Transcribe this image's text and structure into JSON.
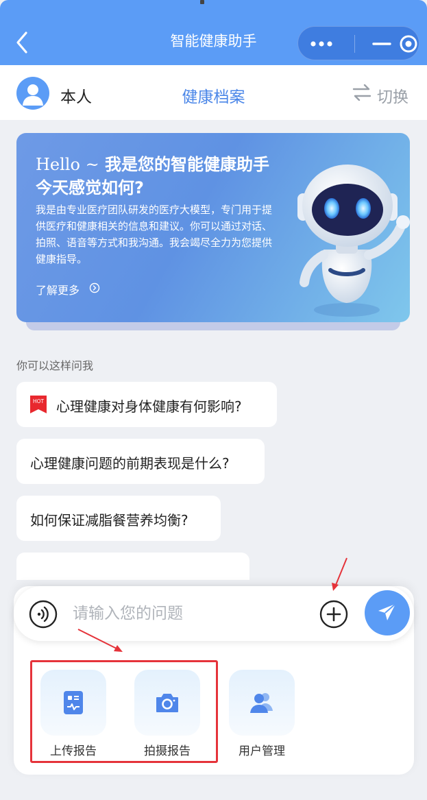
{
  "header": {
    "title": "智能健康助手",
    "back_icon": "chevron-left-icon",
    "capsule_icons": [
      "more-dots-icon",
      "minimize-icon",
      "close-target-icon"
    ]
  },
  "userbar": {
    "user_name": "本人",
    "center_tab": "健康档案",
    "switch_label": "切换",
    "switch_icon": "swap-arrows-icon"
  },
  "banner": {
    "greeting_prefix": "Hello ~",
    "greeting_rest": "我是您的智能健康助手",
    "subtitle": "今天感觉如何?",
    "description": "我是由专业医疗团队研发的医疗大模型，专门用于提供医疗和健康相关的信息和建议。你可以通过对话、拍照、语音等方式和我沟通。我会竭尽全力为您提供健康指导。",
    "learn_more": "了解更多",
    "illustration": "robot-illustration"
  },
  "suggestions": {
    "label": "你可以这样问我",
    "hot_badge": "HOT",
    "items": [
      "心理健康对身体健康有何影响?",
      "心理健康问题的前期表现是什么?",
      "如何保证减脂餐营养均衡?"
    ]
  },
  "input": {
    "placeholder": "请输入您的问题"
  },
  "tools": [
    {
      "label": "上传报告",
      "icon": "report-upload-icon"
    },
    {
      "label": "拍摄报告",
      "icon": "camera-icon"
    },
    {
      "label": "用户管理",
      "icon": "users-icon"
    }
  ],
  "colors": {
    "primary": "#5b9cf6",
    "accent_text": "#4a86e8",
    "annotation_red": "#e5333a",
    "hot_red": "#e8282e"
  }
}
